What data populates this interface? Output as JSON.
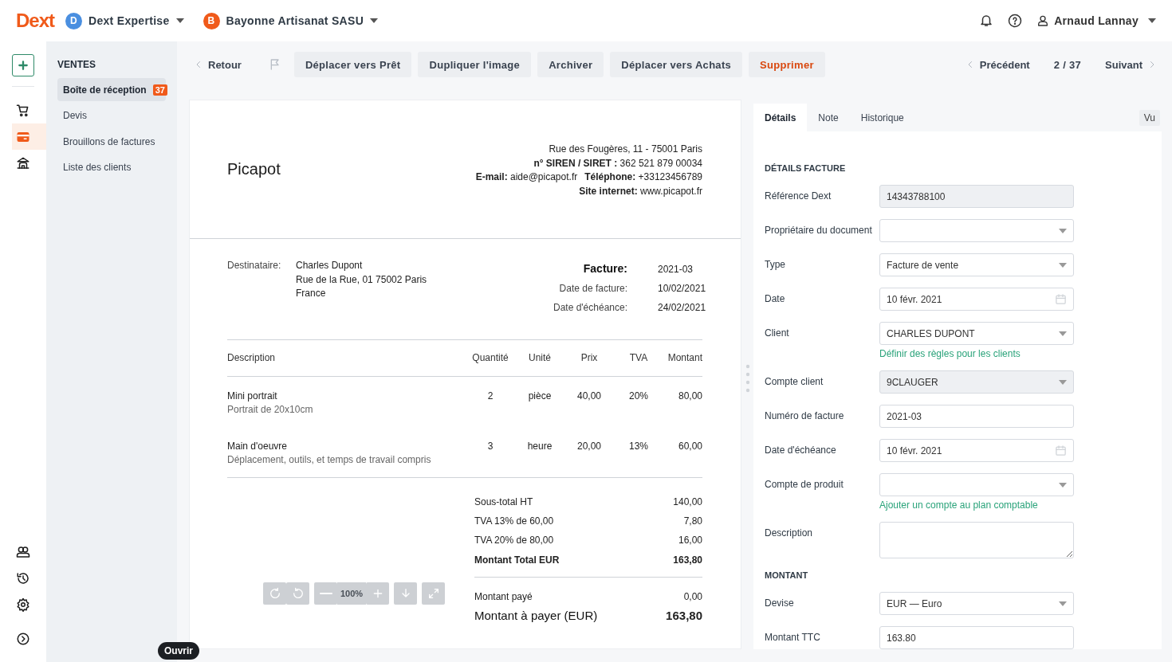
{
  "brand": {
    "logo": "Dext"
  },
  "workspaces": [
    {
      "initial": "D",
      "name": "Dext Expertise",
      "color": "#4a8fe0"
    },
    {
      "initial": "B",
      "name": "Bayonne Artisanat SASU",
      "color": "#f05a1a"
    }
  ],
  "user": {
    "name": "Arnaud Lannay"
  },
  "rail": {
    "top": [
      {
        "kind": "cart",
        "selected": false
      },
      {
        "kind": "card",
        "selected": true
      },
      {
        "kind": "bank",
        "selected": false
      }
    ],
    "bottom": [
      {
        "kind": "contacts",
        "selected": false
      },
      {
        "kind": "history",
        "selected": false
      },
      {
        "kind": "settings",
        "selected": false
      },
      {
        "kind": "expand",
        "selected": false
      }
    ]
  },
  "sidebar": {
    "heading": "VENTES",
    "items": [
      {
        "label": "Boîte de réception",
        "badge": "37",
        "selected": true
      },
      {
        "label": "Devis",
        "selected": false
      },
      {
        "label": "Brouillons de factures",
        "selected": false
      },
      {
        "label": "Liste des clients",
        "selected": false
      }
    ]
  },
  "toolbar": {
    "back": "Retour",
    "actions": [
      {
        "label": "Déplacer vers Prêt",
        "kind": "normal"
      },
      {
        "label": "Dupliquer l'image",
        "kind": "normal"
      },
      {
        "label": "Archiver",
        "kind": "normal"
      },
      {
        "label": "Déplacer vers Achats",
        "kind": "normal"
      },
      {
        "label": "Supprimer",
        "kind": "danger"
      }
    ],
    "pager": {
      "previous": "Précédent",
      "position": "2 / 37",
      "next": "Suivant"
    }
  },
  "document": {
    "vendor": "Picapot",
    "vendor_lines": [
      [
        "Rue des Fougères, 11 - 75001 Paris"
      ],
      [
        "**n° SIREN / SIRET :** 362 521 879 00034"
      ],
      [
        "**E-mail:** aide@picapot.fr",
        "**Téléphone:** +33123456789"
      ],
      [
        "**Site internet:** www.picapot.fr"
      ]
    ],
    "recipient_label": "Destinataire:",
    "recipient_lines": [
      "Charles Dupont",
      "Rue de la Rue, 01 75002 Paris",
      "France"
    ],
    "meta": [
      {
        "label": "Facture:",
        "value": "2021-03",
        "kind": "title"
      },
      {
        "label": "Date de facture:",
        "value": "10/02/2021",
        "kind": "plain"
      },
      {
        "label": "Date d'échéance:",
        "value": "24/02/2021",
        "kind": "plain"
      }
    ],
    "columns": [
      "Description",
      "Quantité",
      "Unité",
      "Prix",
      "TVA",
      "Montant"
    ],
    "rows": [
      {
        "description": "Mini portrait",
        "detail": "Portrait de 20x10cm",
        "quantity": "2",
        "unit": "pièce",
        "price": "40,00",
        "vat": "20%",
        "amount": "80,00"
      },
      {
        "description": "Main d'oeuvre",
        "detail": "Déplacement, outils, et temps de travail compris",
        "quantity": "3",
        "unit": "heure",
        "price": "20,00",
        "vat": "13%",
        "amount": "60,00"
      }
    ],
    "totals": [
      {
        "label": "Sous-total HT",
        "value": "140,00",
        "kind": "plain"
      },
      {
        "label": "TVA 13% de 60,00",
        "value": "7,80",
        "kind": "plain"
      },
      {
        "label": "TVA 20% de 80,00",
        "value": "16,00",
        "kind": "plain"
      },
      {
        "label": "Montant Total EUR",
        "value": "163,80",
        "kind": "bold"
      },
      {
        "label": "Montant payé",
        "value": "0,00",
        "kind": "paid"
      },
      {
        "label": "Montant à payer (EUR)",
        "value": "163,80",
        "kind": "due"
      }
    ]
  },
  "viewer": {
    "zoom": "100%"
  },
  "panel": {
    "tabs": [
      {
        "label": "Détails",
        "selected": true
      },
      {
        "label": "Note",
        "selected": false
      },
      {
        "label": "Historique",
        "selected": false
      }
    ],
    "seen_button": "Vu",
    "sections": [
      {
        "heading": "DÉTAILS FACTURE",
        "fields": [
          {
            "label": "Référence Dext",
            "kind": "text",
            "value": "14343788100",
            "disabled": true
          },
          {
            "label": "Propriétaire du document",
            "kind": "select",
            "disabled": false
          },
          {
            "label": "Type",
            "kind": "select",
            "value": "Facture de vente",
            "disabled": false
          },
          {
            "label": "Date",
            "kind": "date",
            "value": "10 févr. 2021",
            "disabled": false
          },
          {
            "label": "Client",
            "kind": "select",
            "value": "CHARLES DUPONT",
            "disabled": false,
            "link": "Définir des règles pour les clients"
          },
          {
            "label": "Compte client",
            "kind": "select",
            "value": "9CLAUGER",
            "disabled": true
          },
          {
            "label": "Numéro de facture",
            "kind": "text",
            "value": "2021-03",
            "disabled": false
          },
          {
            "label": "Date d'échéance",
            "kind": "date",
            "value": "10 févr. 2021",
            "disabled": false
          },
          {
            "label": "Compte de produit",
            "kind": "select",
            "disabled": false,
            "link": "Ajouter un compte au plan comptable"
          },
          {
            "label": "Description",
            "kind": "textarea",
            "disabled": false
          }
        ]
      },
      {
        "heading": "MONTANT",
        "fields": [
          {
            "label": "Devise",
            "kind": "select",
            "value": "EUR — Euro",
            "disabled": false
          },
          {
            "label": "Montant TTC",
            "kind": "text",
            "value": "163.80",
            "disabled": false
          }
        ]
      }
    ]
  },
  "tooltip": {
    "text": "Ouvrir"
  }
}
